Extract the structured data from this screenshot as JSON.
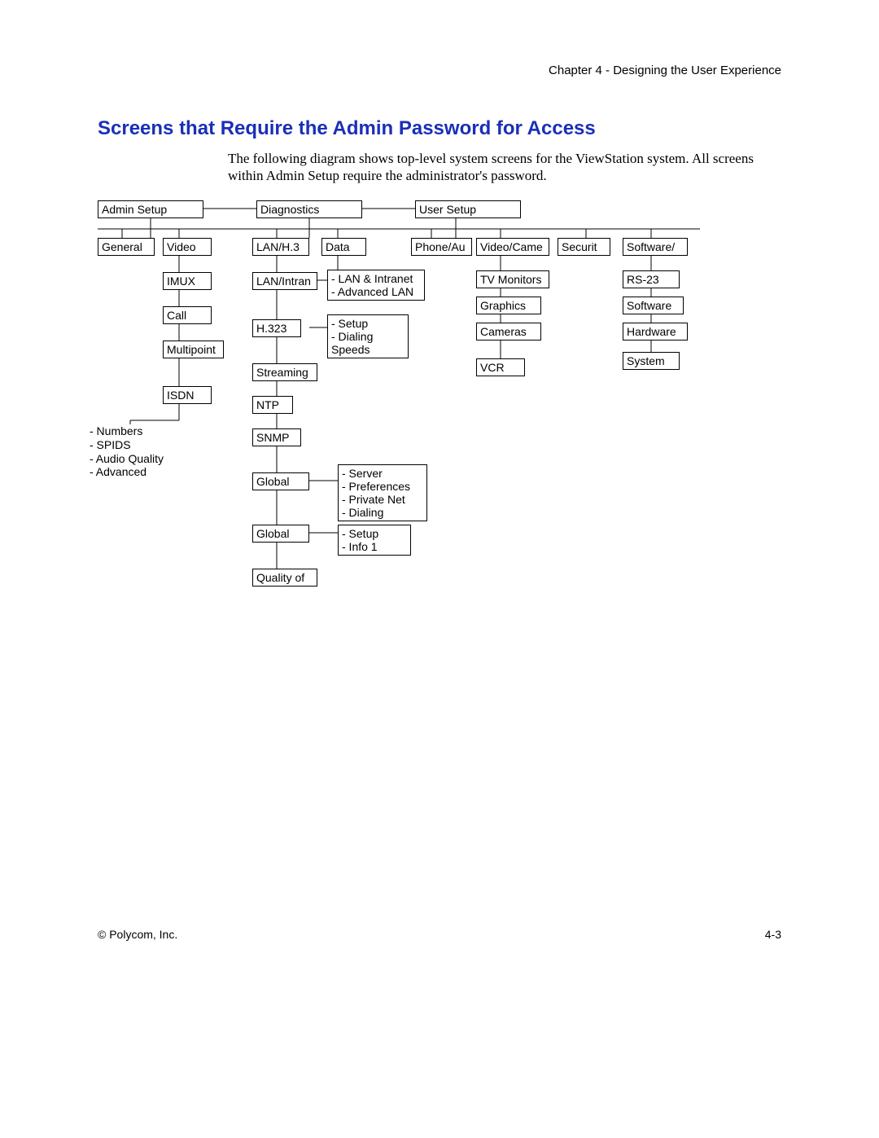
{
  "header": {
    "right": "Chapter 4 - Designing the User Experience"
  },
  "title": "Screens that Require the Admin Password for Access",
  "body": "The following diagram shows top-level system screens for the ViewStation system. All screens within Admin Setup require the administrator's password.",
  "footer": {
    "left": "© Polycom, Inc.",
    "page": "4-3"
  },
  "diagram": {
    "top_nodes": {
      "admin_setup": "Admin Setup",
      "diagnostics": "Diagnostics",
      "user_setup": "User Setup"
    },
    "row2": {
      "general": "General",
      "video": "Video",
      "lan_h3": "LAN/H.3",
      "data": "Data",
      "phone_au": "Phone/Au",
      "video_camera": "Video/Came",
      "security": "Securit",
      "software": "Software/"
    },
    "video_chain": {
      "imux": "IMUX",
      "call": "Call",
      "multipoint": "Multipoint",
      "isdn": "ISDN"
    },
    "isdn_bullets": "- Numbers\n- SPIDS\n- Audio Quality\n- Advanced",
    "lan_chain": {
      "lan_intranet": "LAN/Intran",
      "h323": "H.323",
      "streaming": "Streaming",
      "ntp": "NTP",
      "snmp": "SNMP",
      "global1": "Global",
      "global2": "Global",
      "quality": "Quality of"
    },
    "data_block1": "- LAN & Intranet\n- Advanced LAN",
    "data_block2": "- Setup\n- Dialing\nSpeeds",
    "global1_side": "- Server\n- Preferences\n- Private Net\n- Dialing",
    "global2_side": "- Setup\n- Info 1",
    "video_camera_chain": {
      "tv_monitors": "TV Monitors",
      "graphics": "Graphics",
      "cameras": "Cameras",
      "vcr": "VCR"
    },
    "software_chain": {
      "rs23": "RS-23",
      "software": "Software",
      "hardware": "Hardware",
      "system": "System"
    }
  }
}
